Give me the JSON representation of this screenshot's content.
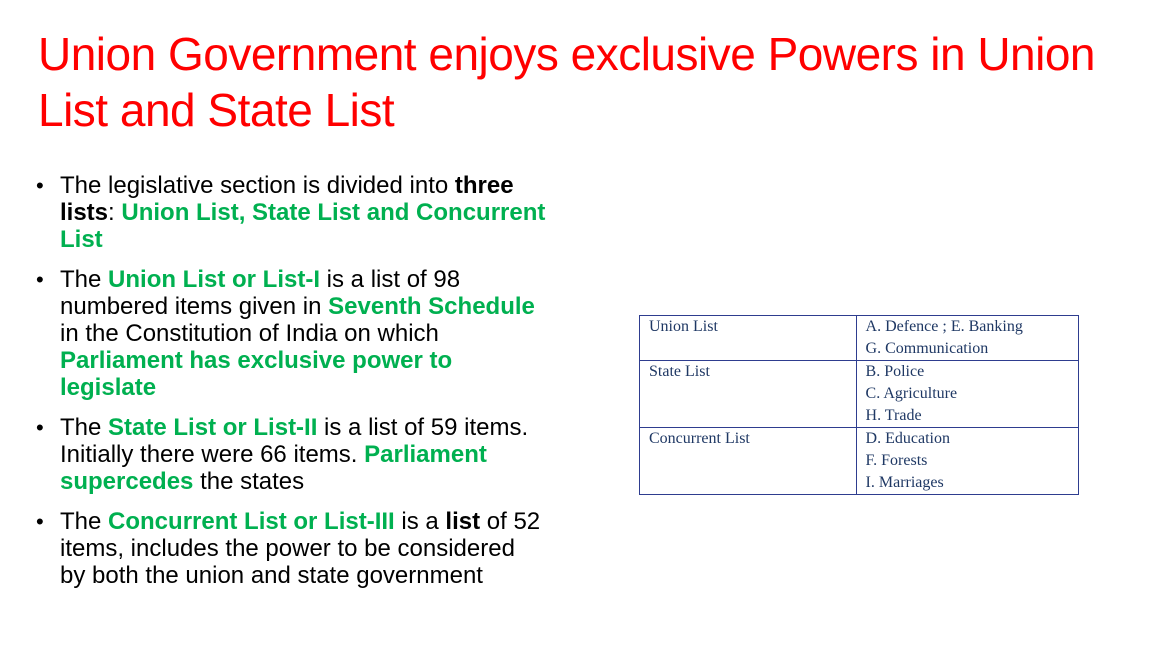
{
  "slide": {
    "title": "Union Government enjoys exclusive Powers in Union List and State List",
    "bullets": [
      {
        "segments": [
          {
            "text": "The legislative section is divided into ",
            "style": "normal"
          },
          {
            "text": "three lists",
            "style": "bold"
          },
          {
            "text": ": ",
            "style": "normal"
          },
          {
            "text": "Union List, State List and Concurrent List",
            "style": "green"
          }
        ]
      },
      {
        "segments": [
          {
            "text": "The ",
            "style": "normal"
          },
          {
            "text": "Union List or List-I",
            "style": "green"
          },
          {
            "text": " is a list of 98 numbered items given in ",
            "style": "normal"
          },
          {
            "text": "Seventh Schedule",
            "style": "green"
          },
          {
            "text": " in the Constitution of India on which ",
            "style": "normal"
          },
          {
            "text": "Parliament has exclusive power to legislate",
            "style": "green"
          }
        ]
      },
      {
        "segments": [
          {
            "text": "The ",
            "style": "normal"
          },
          {
            "text": "State List or List-II",
            "style": "green"
          },
          {
            "text": " is a list of 59 items. Initially there were 66 items. ",
            "style": "normal"
          },
          {
            "text": "Parliament supercedes",
            "style": "green"
          },
          {
            "text": " the states",
            "style": "normal"
          }
        ]
      },
      {
        "segments": [
          {
            "text": "The ",
            "style": "normal"
          },
          {
            "text": "Concurrent List or List-III",
            "style": "green"
          },
          {
            "text": " is a ",
            "style": "normal"
          },
          {
            "text": "list",
            "style": "bold"
          },
          {
            "text": " of 52 items, includes the power to be considered by both the union and state government",
            "style": "normal"
          }
        ]
      }
    ],
    "bullet_symbol": "•"
  },
  "table": {
    "rows": [
      {
        "list": "Union List",
        "items": [
          "A. Defence ; E. Banking",
          "G. Communication"
        ]
      },
      {
        "list": "State List",
        "items": [
          "B. Police",
          "C. Agriculture",
          "H. Trade"
        ]
      },
      {
        "list": "Concurrent List",
        "items": [
          "D. Education",
          "F. Forests",
          "I. Marriages"
        ]
      }
    ]
  },
  "colors": {
    "title": "#ff0000",
    "highlight": "#00b050",
    "table_text": "#1f3864",
    "table_border": "#2e3d8f"
  }
}
